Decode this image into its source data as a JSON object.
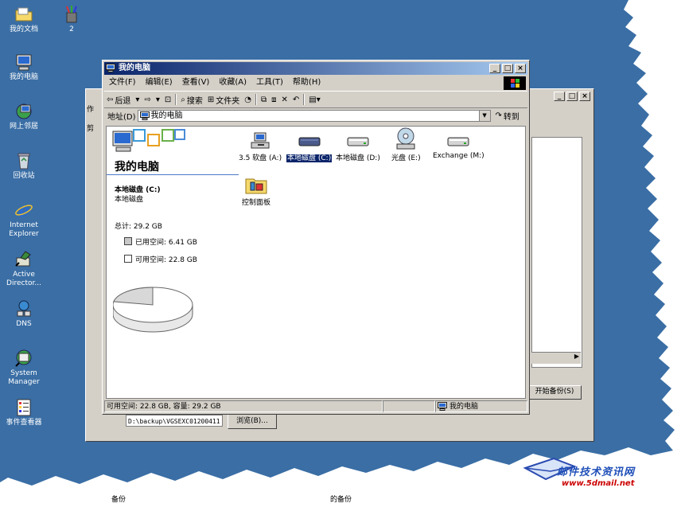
{
  "desktop": {
    "icons": [
      {
        "label": "我的文档"
      },
      {
        "label": "2"
      },
      {
        "label": "我的电脑"
      },
      {
        "label": "网上邻居"
      },
      {
        "label": "回收站"
      },
      {
        "label_line1": "Internet",
        "label_line2": "Explorer"
      },
      {
        "label_line1": "Active",
        "label_line2": "Director..."
      },
      {
        "label": "DNS"
      },
      {
        "label_line1": "System",
        "label_line2": "Manager"
      },
      {
        "label": "事件查看器"
      }
    ]
  },
  "back_window": {
    "side_label1": "作",
    "side_label2": "剪",
    "start_backup_label": "开始备份(S)",
    "path_value": "D:\\backup\\VGSEXC01200411",
    "browse_label": "浏览(B)..."
  },
  "main_window": {
    "title": "我的电脑",
    "menu": [
      "文件(F)",
      "编辑(E)",
      "查看(V)",
      "收藏(A)",
      "工具(T)",
      "帮助(H)"
    ],
    "toolbar": {
      "back": "后退",
      "search": "搜索",
      "folders": "文件夹"
    },
    "address": {
      "label": "地址(D)",
      "value": "我的电脑",
      "go": "转到"
    },
    "left_pane": {
      "title": "我的电脑",
      "drive_name": "本地磁盘 (C:)",
      "drive_type": "本地磁盘",
      "total": "总计: 29.2 GB",
      "used": "已用空间: 6.41 GB",
      "free": "可用空间: 22.8 GB",
      "used_fraction": 0.22
    },
    "items": [
      {
        "label": "3.5 软盘 (A:)",
        "icon": "floppy-icon"
      },
      {
        "label": "本地磁盘 (C:)",
        "icon": "hard-disk-icon",
        "selected": true
      },
      {
        "label": "本地磁盘 (D:)",
        "icon": "hard-disk-icon"
      },
      {
        "label": "光盘 (E:)",
        "icon": "cd-drive-icon"
      },
      {
        "label": "Exchange (M:)",
        "icon": "hard-disk-icon"
      },
      {
        "label": "控制面板",
        "icon": "control-panel-icon"
      }
    ],
    "status": {
      "left": "可用空间: 22.8 GB, 容量: 29.2 GB",
      "right": "我的电脑"
    }
  },
  "watermark": {
    "text": "邮件技术资讯网",
    "url": "www.5dmail.net"
  },
  "bottom": {
    "left_text": "备份",
    "right_text": "的备份"
  },
  "colors": {
    "desktop": "#3a6ea5",
    "titlebar": "#0a246a",
    "chrome": "#d4d0c8"
  }
}
